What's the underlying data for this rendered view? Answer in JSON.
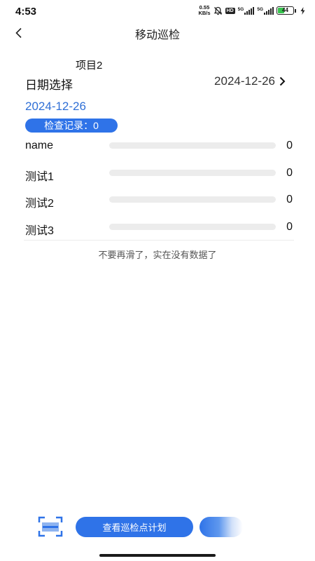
{
  "status_bar": {
    "time": "4:53",
    "speed_value": "0.55",
    "speed_unit": "KB/s",
    "hd_label": "HD",
    "network_1": "5G",
    "network_2": "5G",
    "battery_level": "44",
    "battery_fraction": 0.44,
    "icons": [
      "mute-bell-icon",
      "signal-icon",
      "battery-icon",
      "charging-icon"
    ]
  },
  "nav": {
    "title": "移动巡检",
    "back_icon": "chevron-left-icon"
  },
  "project": {
    "name": "项目2"
  },
  "date_picker": {
    "label": "日期选择",
    "value": "2024-12-26",
    "icon": "chevron-right-icon"
  },
  "selected_date": "2024-12-26",
  "record_badge": "检查记录：0",
  "items": [
    {
      "label": "name",
      "count": "0",
      "progress": 0
    },
    {
      "label": "测试1",
      "count": "0",
      "progress": 0
    },
    {
      "label": "测试2",
      "count": "0",
      "progress": 0
    },
    {
      "label": "测试3",
      "count": "0",
      "progress": 0
    }
  ],
  "list_footer": "不要再滑了，实在没有数据了",
  "actions": {
    "scan_icon": "scan-icon",
    "plan_label": "查看巡检点计划"
  },
  "colors": {
    "accent": "#2f73e8",
    "date_text": "#2f6fd6",
    "track": "#ececec",
    "battery": "#37c54e"
  }
}
